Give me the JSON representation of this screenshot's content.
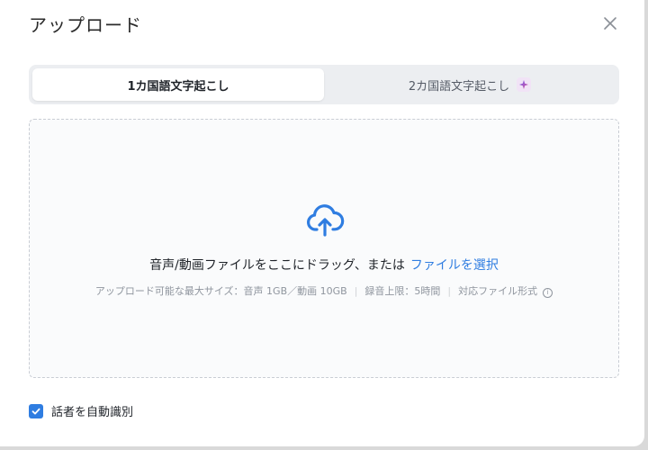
{
  "dialog": {
    "title": "アップロード"
  },
  "tabs": [
    {
      "label": "1カ国語文字起こし",
      "active": true
    },
    {
      "label": "2カ国語文字起こし",
      "active": false,
      "badge_icon": "sparkle-icon"
    }
  ],
  "dropzone": {
    "prompt": "音声/動画ファイルをここにドラッグ、または",
    "select_link": "ファイルを選択",
    "limit_text": "アップロード可能な最大サイズ：音声 1GB／動画 10GB",
    "duration_text": "録音上限：5時間",
    "formats_text": "対応ファイル形式",
    "info_icon": "i"
  },
  "options": {
    "auto_speaker_label": "話者を自動識別",
    "auto_speaker_checked": true
  },
  "colors": {
    "accent": "#2f7de1",
    "text": "#1f2329",
    "muted": "#8f959e"
  }
}
